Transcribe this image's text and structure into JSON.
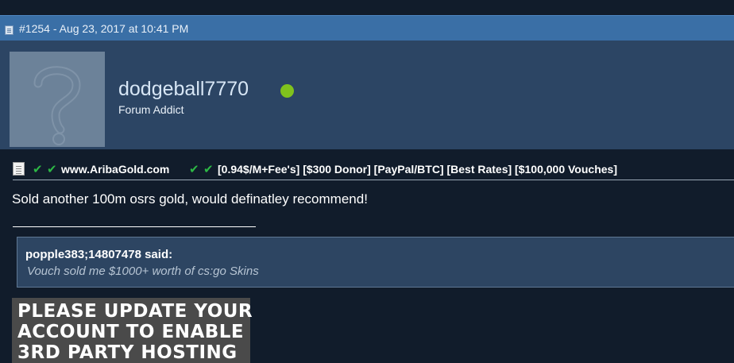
{
  "post": {
    "meta": "#1254 - Aug 23, 2017 at 10:41 PM"
  },
  "user": {
    "name": "dodgeball7770",
    "title": "Forum Addict",
    "status_color": "#80c21d"
  },
  "thread_title": {
    "check_mark": "✔",
    "site": "www.AribaGold.com",
    "rest": "[0.94$/M+Fee's] [$300 Donor] [PayPal/BTC] [Best Rates] [$100,000 Vouches]"
  },
  "message": "Sold another 100m osrs gold, would definatley recommend!",
  "quote": {
    "author": "popple383;14807478 said:",
    "text": "Vouch sold me $1000+ worth of cs:go Skins"
  },
  "hosting_notice": {
    "line1": "PLEASE UPDATE YOUR",
    "line2": "ACCOUNT TO ENABLE",
    "line3": "3RD PARTY HOSTING"
  },
  "colors": {
    "header_bar": "#3a6fa6",
    "userinfo_bg": "#2c4564",
    "page_bg": "#111c2b",
    "check_green": "#2db845"
  }
}
